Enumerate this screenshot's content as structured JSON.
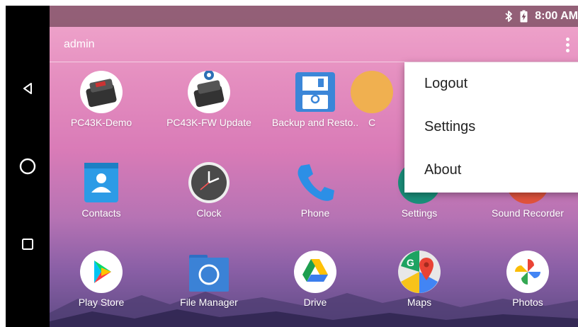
{
  "status": {
    "time": "8:00 AM",
    "icons": [
      "bluetooth-icon",
      "battery-charging-icon"
    ]
  },
  "appbar": {
    "user": "admin",
    "overflow_icon": "more-vert-icon"
  },
  "apps": {
    "row1": [
      {
        "label": "PC43K-Demo",
        "icon": "printer-icon"
      },
      {
        "label": "PC43K-FW Update",
        "icon": "printer-update-icon"
      },
      {
        "label": "Backup and Resto..",
        "icon": "floppy-disk-icon"
      },
      {
        "label": "C",
        "icon": "app-icon"
      }
    ],
    "row2": [
      {
        "label": "Contacts",
        "icon": "contacts-icon"
      },
      {
        "label": "Clock",
        "icon": "clock-icon"
      },
      {
        "label": "Phone",
        "icon": "phone-icon"
      },
      {
        "label": "Settings",
        "icon": "settings-icon"
      },
      {
        "label": "Sound Recorder",
        "icon": "sound-recorder-icon"
      }
    ],
    "row3": [
      {
        "label": "Play Store",
        "icon": "play-store-icon"
      },
      {
        "label": "File Manager",
        "icon": "folder-icon"
      },
      {
        "label": "Drive",
        "icon": "drive-icon"
      },
      {
        "label": "Maps",
        "icon": "maps-icon"
      },
      {
        "label": "Photos",
        "icon": "photos-icon"
      }
    ]
  },
  "menu": {
    "items": [
      "Logout",
      "Settings",
      "About"
    ]
  },
  "colors": {
    "status_bar": "#7a4b60",
    "menu_bg": "#ffffff",
    "contacts_blue": "#2c9be6",
    "folder_blue": "#3b82d6"
  }
}
